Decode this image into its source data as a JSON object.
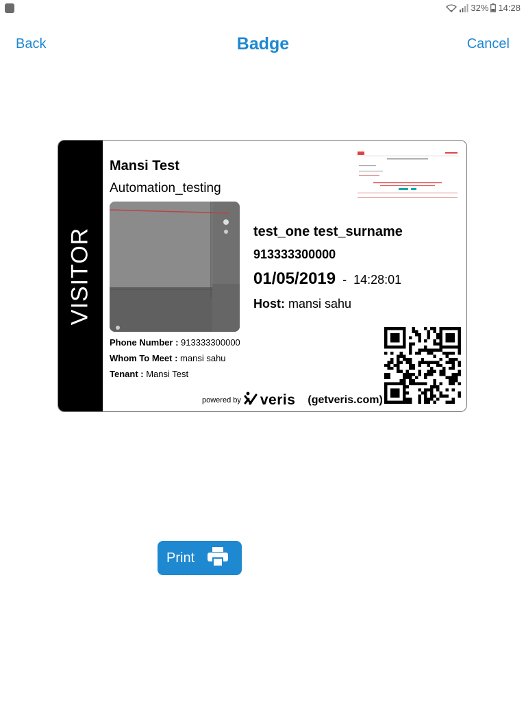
{
  "status_bar": {
    "battery": "32%",
    "time": "14:28"
  },
  "nav": {
    "back": "Back",
    "title": "Badge",
    "cancel": "Cancel"
  },
  "badge": {
    "visitor_label": "VISITOR",
    "tenant_name": "Mansi Test",
    "tenant_dept": "Automation_testing",
    "visitor_name": "test_one test_surname",
    "visitor_phone": "913333300000",
    "date": "01/05/2019",
    "separator": "-",
    "time": "14:28:01",
    "host_label": "Host:",
    "host_name": "mansi sahu",
    "details": [
      {
        "label": "Phone Number :",
        "value": "913333300000"
      },
      {
        "label": "Whom To Meet :",
        "value": "mansi sahu"
      },
      {
        "label": "Tenant :",
        "value": "Mansi Test"
      }
    ],
    "powered_by": "powered by",
    "brand": "veris",
    "website": "(getveris.com)"
  },
  "print": {
    "label": "Print"
  },
  "colors": {
    "accent": "#1e88d1",
    "badge_strip": "#000000"
  },
  "icons": [
    "wifi-icon",
    "signal-icon",
    "battery-icon",
    "printer-icon",
    "veris-logo-icon",
    "qr-code"
  ]
}
